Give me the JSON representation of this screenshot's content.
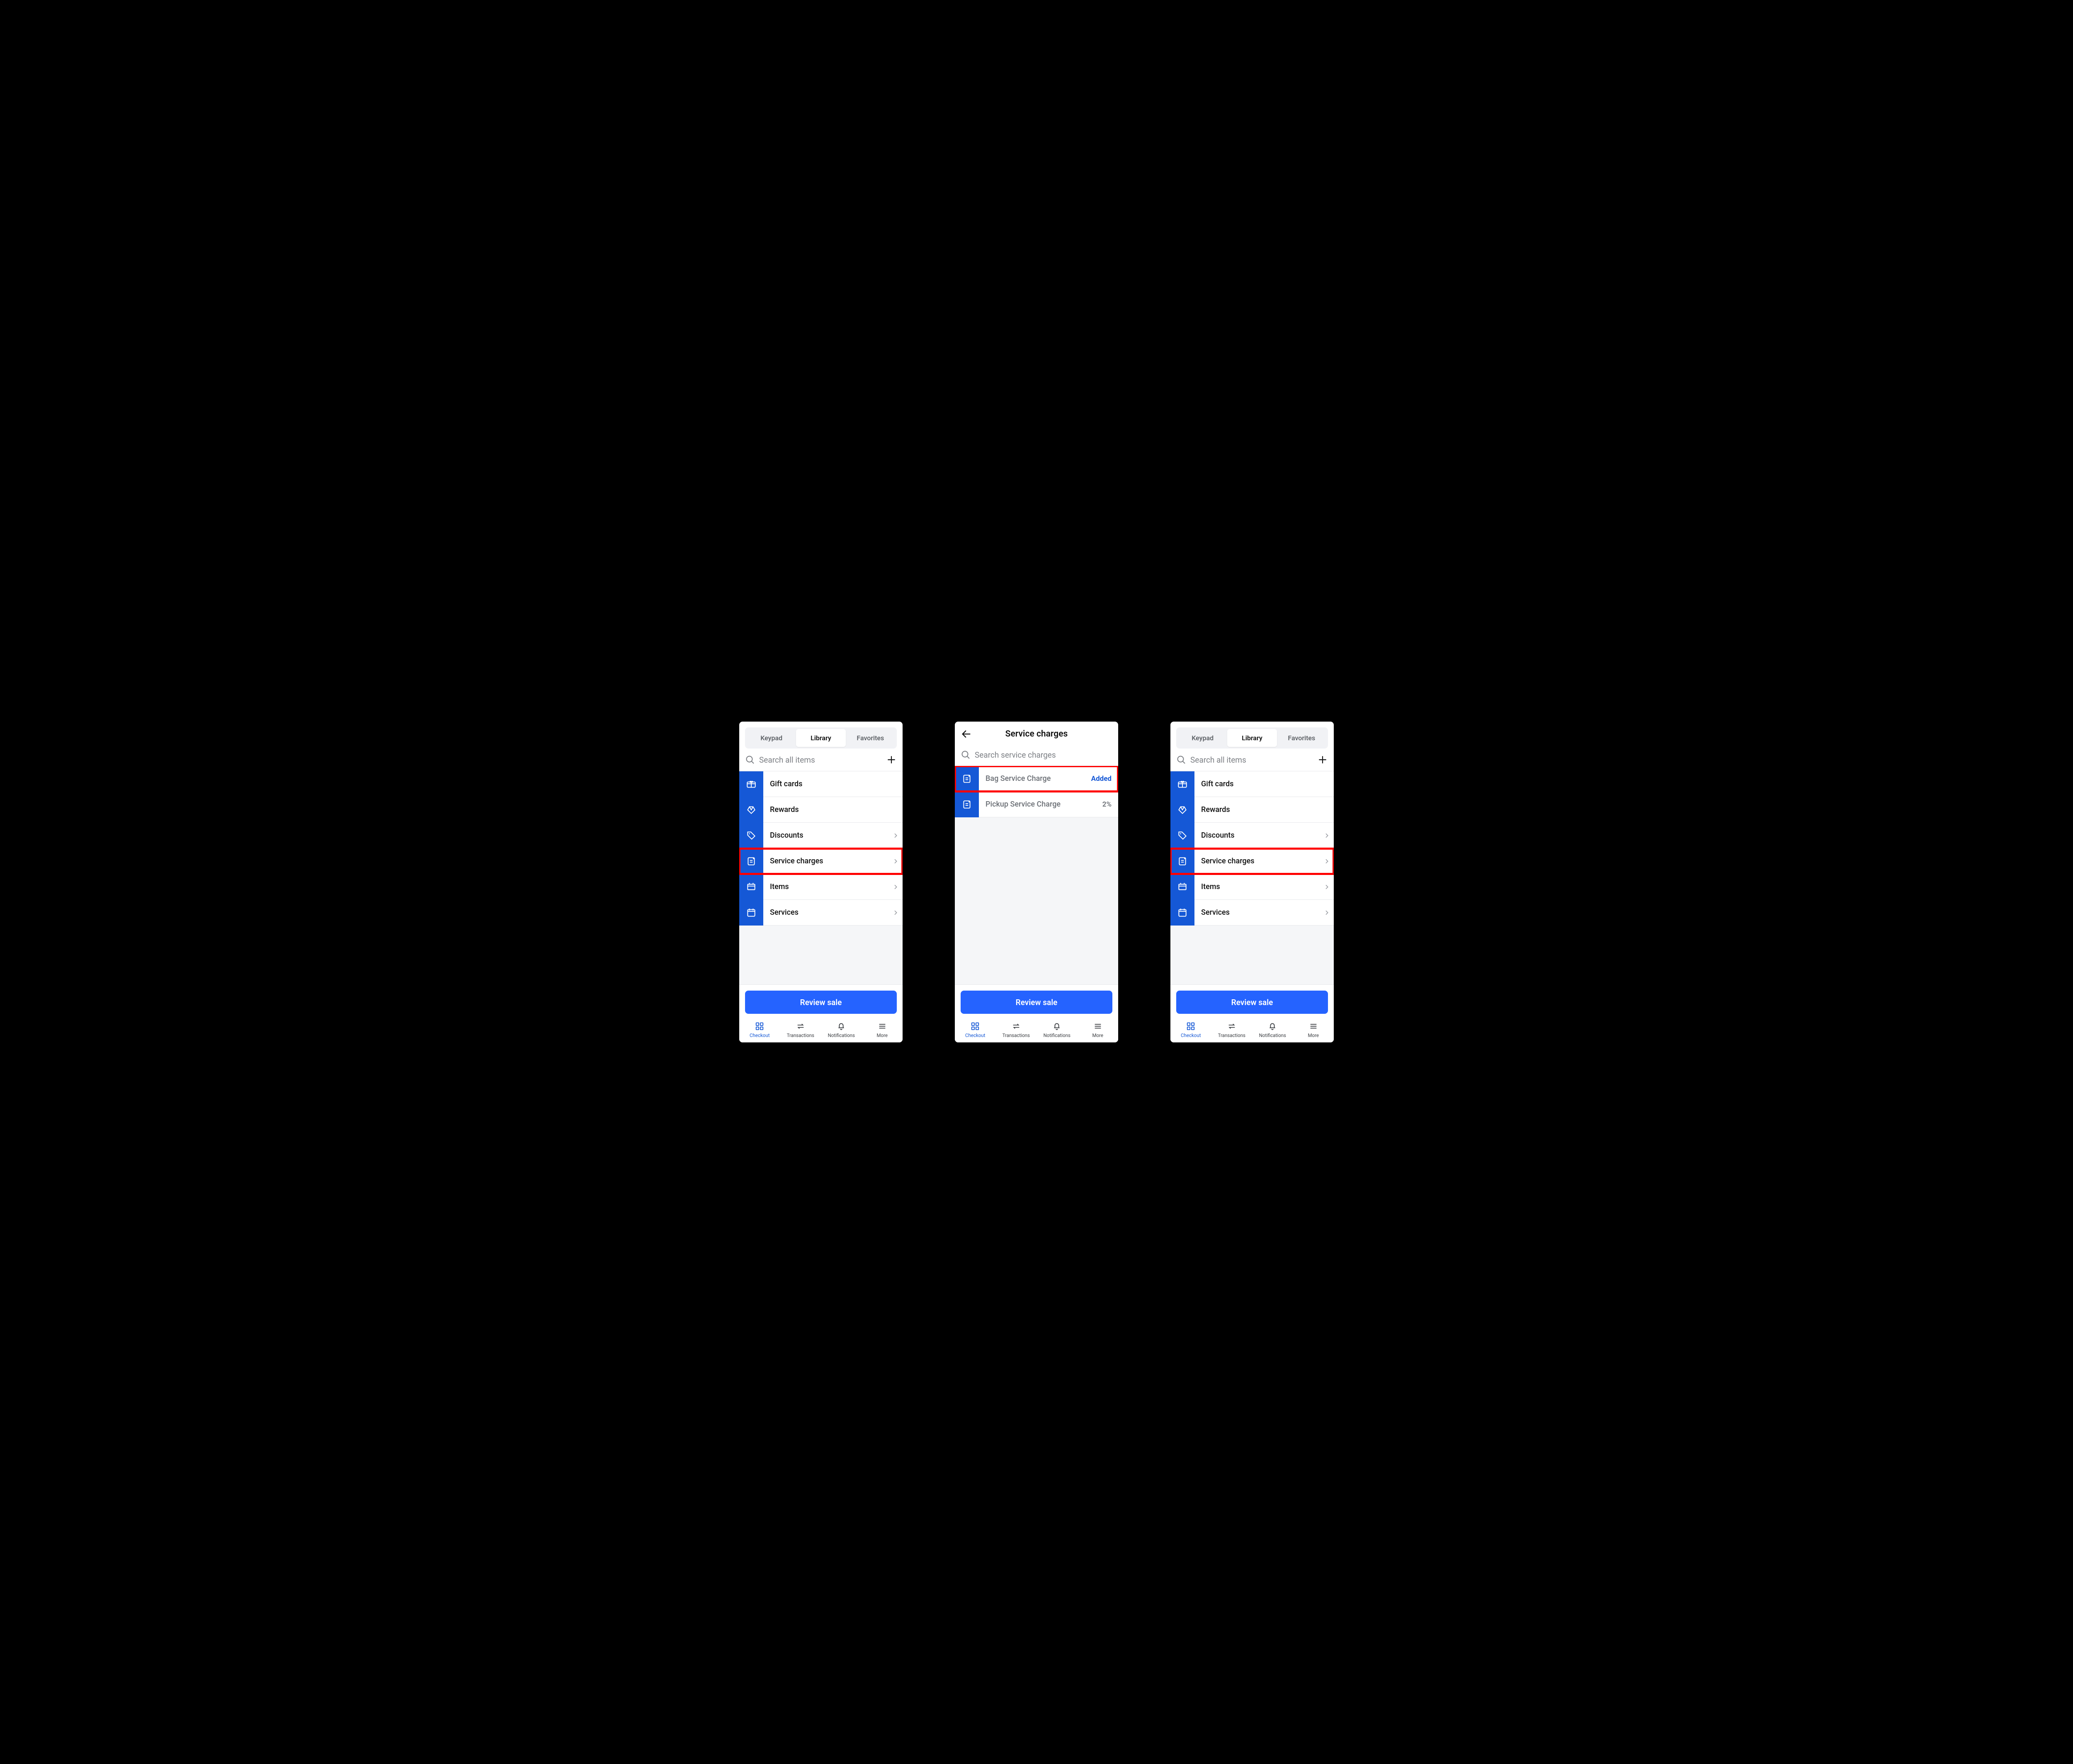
{
  "tabs": {
    "keypad": "Keypad",
    "library": "Library",
    "favorites": "Favorites"
  },
  "search": {
    "items_placeholder": "Search all items",
    "sc_placeholder": "Search service charges"
  },
  "library_menu": {
    "gift_cards": "Gift cards",
    "rewards": "Rewards",
    "discounts": "Discounts",
    "service_charges": "Service charges",
    "items": "Items",
    "services": "Services"
  },
  "service_charges_screen": {
    "title": "Service charges",
    "rows": {
      "bag": {
        "label": "Bag Service Charge",
        "right": "Added"
      },
      "pickup": {
        "label": "Pickup Service Charge",
        "right": "2%"
      }
    }
  },
  "review_button": "Review sale",
  "bottom_nav": {
    "checkout": "Checkout",
    "transactions": "Transactions",
    "notifications": "Notifications",
    "more": "More"
  }
}
